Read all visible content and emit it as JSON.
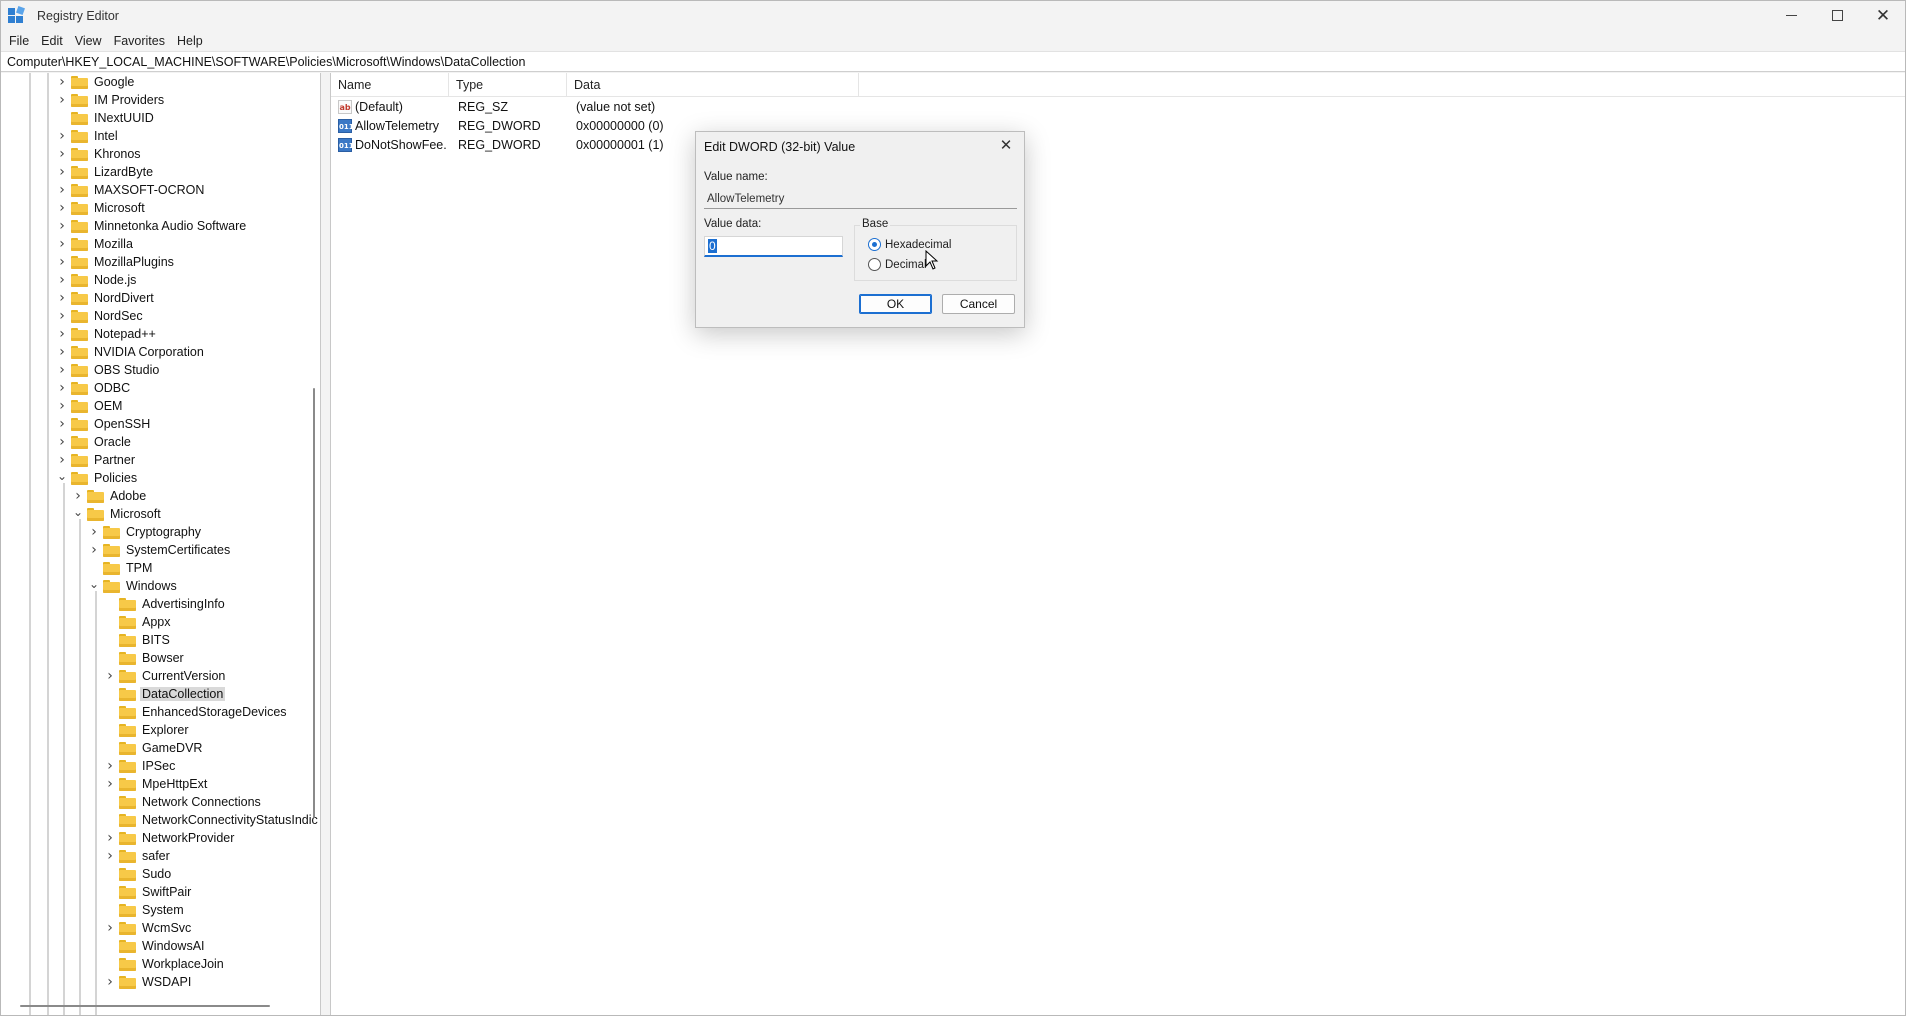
{
  "window": {
    "title": "Registry Editor"
  },
  "menubar": [
    "File",
    "Edit",
    "View",
    "Favorites",
    "Help"
  ],
  "address": "Computer\\HKEY_LOCAL_MACHINE\\SOFTWARE\\Policies\\Microsoft\\Windows\\DataCollection",
  "tree": {
    "nodes": [
      {
        "label": "Google",
        "level": 0,
        "expander": "collapsed"
      },
      {
        "label": "IM Providers",
        "level": 0,
        "expander": "collapsed"
      },
      {
        "label": "INextUUID",
        "level": 0,
        "expander": "none"
      },
      {
        "label": "Intel",
        "level": 0,
        "expander": "collapsed"
      },
      {
        "label": "Khronos",
        "level": 0,
        "expander": "collapsed"
      },
      {
        "label": "LizardByte",
        "level": 0,
        "expander": "collapsed"
      },
      {
        "label": "MAXSOFT-OCRON",
        "level": 0,
        "expander": "collapsed"
      },
      {
        "label": "Microsoft",
        "level": 0,
        "expander": "collapsed"
      },
      {
        "label": "Minnetonka Audio Software",
        "level": 0,
        "expander": "collapsed"
      },
      {
        "label": "Mozilla",
        "level": 0,
        "expander": "collapsed"
      },
      {
        "label": "MozillaPlugins",
        "level": 0,
        "expander": "collapsed"
      },
      {
        "label": "Node.js",
        "level": 0,
        "expander": "collapsed"
      },
      {
        "label": "NordDivert",
        "level": 0,
        "expander": "collapsed"
      },
      {
        "label": "NordSec",
        "level": 0,
        "expander": "collapsed"
      },
      {
        "label": "Notepad++",
        "level": 0,
        "expander": "collapsed"
      },
      {
        "label": "NVIDIA Corporation",
        "level": 0,
        "expander": "collapsed"
      },
      {
        "label": "OBS Studio",
        "level": 0,
        "expander": "collapsed"
      },
      {
        "label": "ODBC",
        "level": 0,
        "expander": "collapsed"
      },
      {
        "label": "OEM",
        "level": 0,
        "expander": "collapsed"
      },
      {
        "label": "OpenSSH",
        "level": 0,
        "expander": "collapsed"
      },
      {
        "label": "Oracle",
        "level": 0,
        "expander": "collapsed"
      },
      {
        "label": "Partner",
        "level": 0,
        "expander": "collapsed"
      },
      {
        "label": "Policies",
        "level": 0,
        "expander": "expanded"
      },
      {
        "label": "Adobe",
        "level": 1,
        "expander": "collapsed"
      },
      {
        "label": "Microsoft",
        "level": 1,
        "expander": "expanded"
      },
      {
        "label": "Cryptography",
        "level": 2,
        "expander": "collapsed"
      },
      {
        "label": "SystemCertificates",
        "level": 2,
        "expander": "collapsed"
      },
      {
        "label": "TPM",
        "level": 2,
        "expander": "none"
      },
      {
        "label": "Windows",
        "level": 2,
        "expander": "expanded"
      },
      {
        "label": "AdvertisingInfo",
        "level": 3,
        "expander": "none"
      },
      {
        "label": "Appx",
        "level": 3,
        "expander": "none"
      },
      {
        "label": "BITS",
        "level": 3,
        "expander": "none"
      },
      {
        "label": "Bowser",
        "level": 3,
        "expander": "none"
      },
      {
        "label": "CurrentVersion",
        "level": 3,
        "expander": "collapsed"
      },
      {
        "label": "DataCollection",
        "level": 3,
        "expander": "none",
        "selected": true
      },
      {
        "label": "EnhancedStorageDevices",
        "level": 3,
        "expander": "none"
      },
      {
        "label": "Explorer",
        "level": 3,
        "expander": "none"
      },
      {
        "label": "GameDVR",
        "level": 3,
        "expander": "none"
      },
      {
        "label": "IPSec",
        "level": 3,
        "expander": "collapsed"
      },
      {
        "label": "MpeHttpExt",
        "level": 3,
        "expander": "collapsed"
      },
      {
        "label": "Network Connections",
        "level": 3,
        "expander": "none"
      },
      {
        "label": "NetworkConnectivityStatusIndic",
        "level": 3,
        "expander": "none"
      },
      {
        "label": "NetworkProvider",
        "level": 3,
        "expander": "collapsed"
      },
      {
        "label": "safer",
        "level": 3,
        "expander": "collapsed"
      },
      {
        "label": "Sudo",
        "level": 3,
        "expander": "none"
      },
      {
        "label": "SwiftPair",
        "level": 3,
        "expander": "none"
      },
      {
        "label": "System",
        "level": 3,
        "expander": "none"
      },
      {
        "label": "WcmSvc",
        "level": 3,
        "expander": "collapsed"
      },
      {
        "label": "WindowsAI",
        "level": 3,
        "expander": "none"
      },
      {
        "label": "WorkplaceJoin",
        "level": 3,
        "expander": "none"
      },
      {
        "label": "WSDAPI",
        "level": 3,
        "expander": "collapsed"
      }
    ]
  },
  "list": {
    "columns": [
      "Name",
      "Type",
      "Data"
    ],
    "rows": [
      {
        "icon": "string-value-icon",
        "name": "(Default)",
        "type": "REG_SZ",
        "data": "(value not set)"
      },
      {
        "icon": "dword-value-icon",
        "name": "AllowTelemetry",
        "type": "REG_DWORD",
        "data": "0x00000000 (0)"
      },
      {
        "icon": "dword-value-icon",
        "name": "DoNotShowFee...",
        "type": "REG_DWORD",
        "data": "0x00000001 (1)"
      }
    ]
  },
  "dialog": {
    "title": "Edit DWORD (32-bit) Value",
    "value_name_label": "Value name:",
    "value_name": "AllowTelemetry",
    "value_data_label": "Value data:",
    "value_data": "0",
    "base_label": "Base",
    "radio_hex": "Hexadecimal",
    "radio_dec": "Decimal",
    "selected_base": "Hexadecimal",
    "ok_label": "OK",
    "cancel_label": "Cancel"
  },
  "colors": {
    "accent": "#1c6fd1",
    "folder": "#f7c948",
    "selection": "#d9d9d9"
  }
}
